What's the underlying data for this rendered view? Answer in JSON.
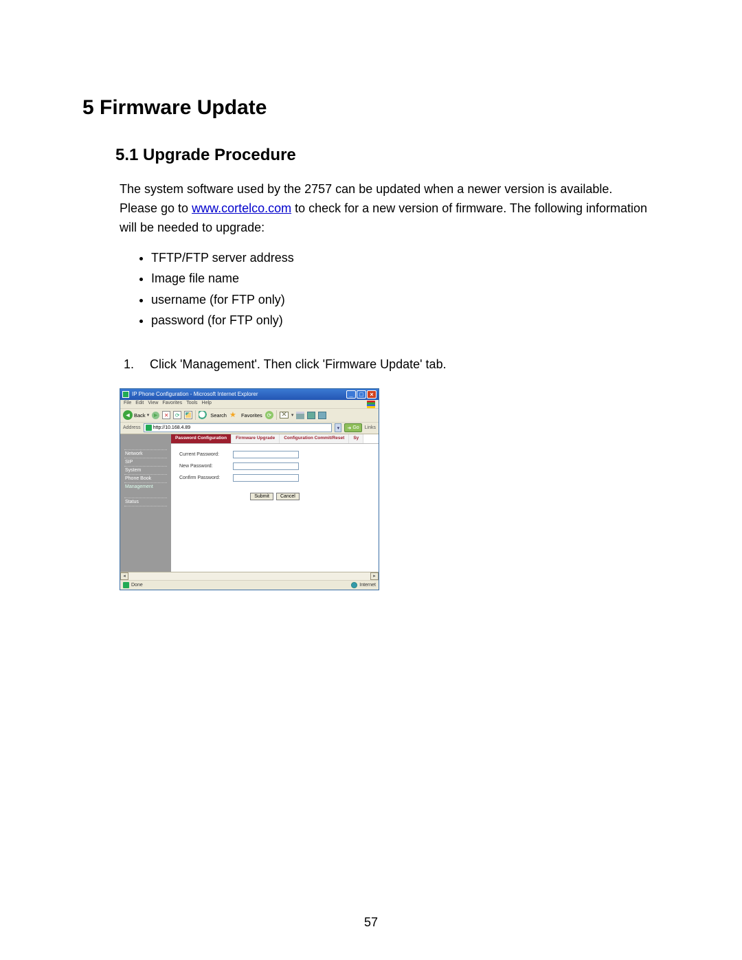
{
  "chapter_heading": "5   Firmware Update",
  "section_heading": "5.1 Upgrade Procedure",
  "intro_para_pre": "The system software used by the 2757 can be updated when a newer version is available. Please go to ",
  "intro_link_text": "www.cortelco.com",
  "intro_para_post": " to check for a new version of firmware.   The following information will be needed to upgrade:",
  "bullets": [
    "TFTP/FTP server address",
    "Image file name",
    "username (for FTP only)",
    "password (for FTP only)"
  ],
  "step1": "Click 'Management'.   Then click 'Firmware Update' tab.",
  "page_number": "57",
  "ie": {
    "title": "IP Phone Configuration - Microsoft Internet Explorer",
    "menu": {
      "file": "File",
      "edit": "Edit",
      "view": "View",
      "favorites": "Favorites",
      "tools": "Tools",
      "help": "Help"
    },
    "toolbar": {
      "back": "Back",
      "search": "Search",
      "favorites": "Favorites"
    },
    "address_label": "Address",
    "url": "http://10.168.4.89",
    "go": "Go",
    "links": "Links",
    "sidebar": {
      "network": "Network",
      "sip": "SIP",
      "system": "System",
      "phonebook": "Phone Book",
      "management": "Management",
      "status": "Status"
    },
    "tabs": {
      "password": "Password Configuration",
      "firmware": "Firmware Upgrade",
      "commit": "Configuration Commit/Reset",
      "sy": "Sy"
    },
    "form": {
      "current": "Current Password:",
      "new": "New Password:",
      "confirm": "Confirm Password:",
      "submit": "Submit",
      "cancel": "Cancel"
    },
    "status": {
      "done": "Done",
      "zone": "Internet"
    }
  }
}
